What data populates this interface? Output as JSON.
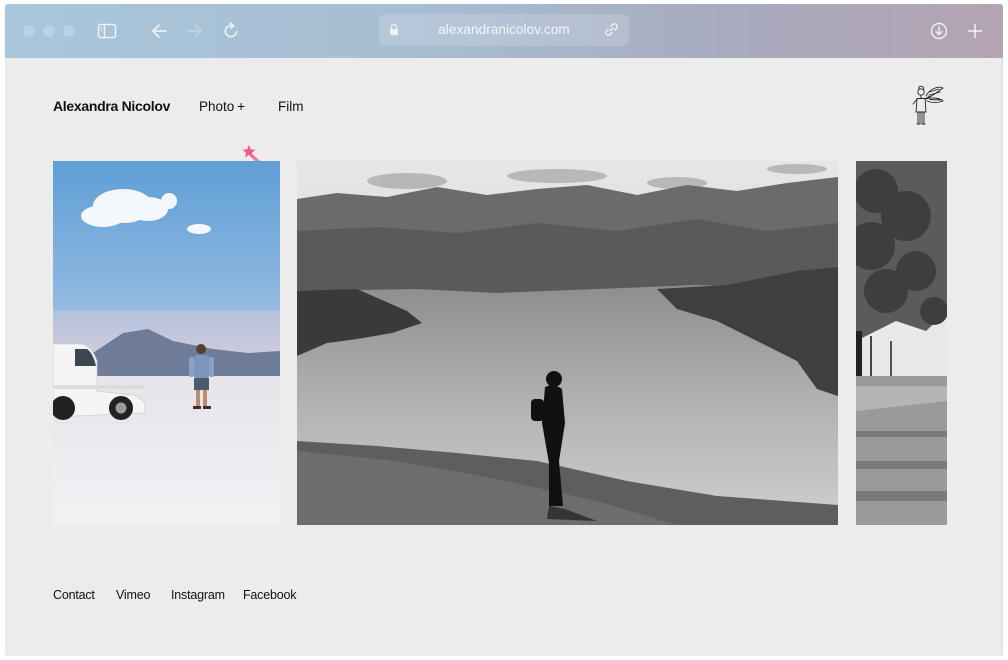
{
  "browser": {
    "url": "alexandranicolov.com"
  },
  "site": {
    "title": "Alexandra Nicolov",
    "nav": {
      "photo": "Photo",
      "photo_expand": "+",
      "film": "Film"
    }
  },
  "gallery": {
    "photos": [
      {
        "subject": "salt-flats-van-person"
      },
      {
        "subject": "lake-mountains-silhouette"
      },
      {
        "subject": "park-trees"
      }
    ]
  },
  "footer": {
    "links": [
      "Contact",
      "Vimeo",
      "Instagram",
      "Facebook"
    ]
  },
  "colors": {
    "toolbar_start": "#a9c6dc",
    "toolbar_end": "#b4a3b1",
    "page_bg": "#ececec",
    "wand_pink": "#f07ca0"
  }
}
